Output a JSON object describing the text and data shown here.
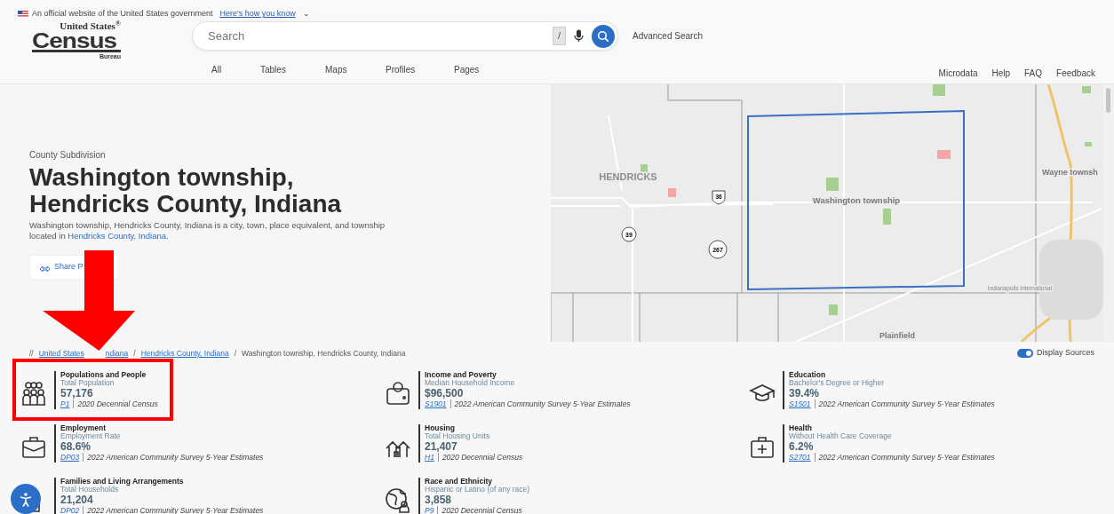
{
  "gov_banner": {
    "text": "An official website of the United States government",
    "link": "Here's how you know",
    "caret": "⌄"
  },
  "logo": {
    "top": "United States$^{®}$",
    "main": "Census",
    "bottom": "Bureau"
  },
  "search": {
    "placeholder": "Search",
    "shortcut_key": "/"
  },
  "advanced_search": "Advanced Search",
  "search_tabs": [
    "All",
    "Tables",
    "Maps",
    "Profiles",
    "Pages"
  ],
  "utility_links": [
    "Microdata",
    "Help",
    "FAQ",
    "Feedback"
  ],
  "hero": {
    "eyebrow": "County Subdivision",
    "title": "Washington township, Hendricks County, Indiana",
    "description": "Washington township, Hendricks County, Indiana is a city, town, place equivalent, and township located in ",
    "description_link": "Hendricks County, Indiana",
    "description_end": ".",
    "share_button": "Share P"
  },
  "map": {
    "labels": [
      {
        "kind": "county",
        "text": "HENDRICKS"
      },
      {
        "kind": "township",
        "text": "Washington township"
      },
      {
        "kind": "edge",
        "text": "Wayne townsh"
      },
      {
        "kind": "airport",
        "text": "Indianapolis International"
      },
      {
        "kind": "shield",
        "text": "36"
      },
      {
        "kind": "circle",
        "text": "39"
      },
      {
        "kind": "circle",
        "text": "267"
      },
      {
        "kind": "cut",
        "text": "Plainfield"
      }
    ]
  },
  "breadcrumb": [
    {
      "kind": "prefix",
      "text": "//"
    },
    {
      "kind": "link",
      "text": "United States"
    },
    {
      "kind": "link",
      "text": "ndiana"
    },
    {
      "kind": "separator",
      "text": "/"
    },
    {
      "kind": "link",
      "text": "Hendricks County, Indiana"
    },
    {
      "kind": "separator",
      "text": "/"
    },
    {
      "kind": "current",
      "text": "Washington township, Hendricks County, Indiana"
    }
  ],
  "display_sources": {
    "label": "Display Sources",
    "on": true
  },
  "stats": [
    {
      "category": "Populations and People",
      "metric": "Total Population",
      "value": "57,176",
      "source_id": "P1",
      "source": "2020 Decennial Census"
    },
    {
      "category": "Income and Poverty",
      "metric": "Median Household Income",
      "value": "$96,500",
      "source_id": "S1901",
      "source": "2022 American Community Survey 5-Year Estimates"
    },
    {
      "category": "Education",
      "metric": "Bachelor's Degree or Higher",
      "value": "39.4%",
      "source_id": "S1501",
      "source": "2022 American Community Survey 5-Year Estimates"
    },
    {
      "category": "Employment",
      "metric": "Employment Rate",
      "value": "68.6%",
      "source_id": "DP03",
      "source": "2022 American Community Survey 5-Year Estimates"
    },
    {
      "category": "Housing",
      "metric": "Total Housing Units",
      "value": "21,407",
      "source_id": "H1",
      "source": "2020 Decennial Census"
    },
    {
      "category": "Health",
      "metric": "Without Health Care Coverage",
      "value": "6.2%",
      "source_id": "S2701",
      "source": "2022 American Community Survey 5-Year Estimates"
    },
    {
      "category": "Families and Living Arrangements",
      "metric": "Total Households",
      "value": "21,204",
      "source_id": "DP02",
      "source": "2022 American Community Survey 5-Year Estimates"
    },
    {
      "category": "Race and Ethnicity",
      "metric": "Hispanic or Latino (of any race)",
      "value": "3,858",
      "source_id": "P9",
      "source": "2020 Decennial Census"
    }
  ]
}
